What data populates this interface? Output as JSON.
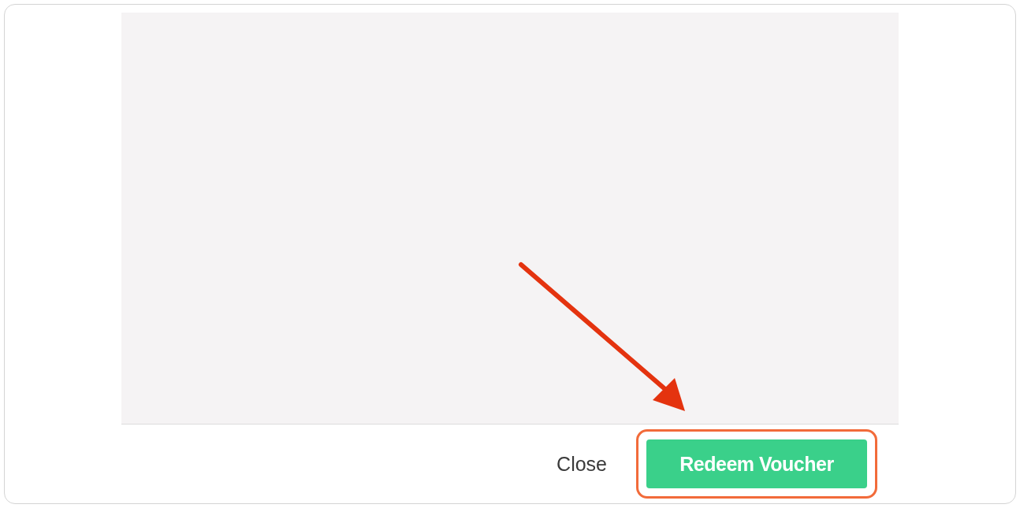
{
  "dialog": {
    "buttons": [
      {
        "label": "Close",
        "kind": "plain",
        "highlighted": false
      },
      {
        "label": "Redeem Voucher",
        "kind": "primary",
        "highlighted": true
      }
    ]
  }
}
